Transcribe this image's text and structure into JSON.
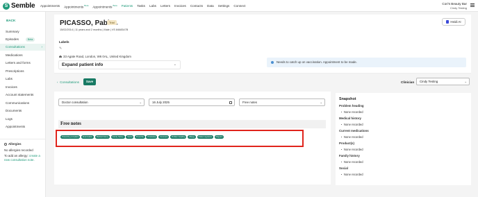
{
  "nav": {
    "logo": "Semble",
    "links": [
      {
        "label": "Appointments",
        "badge": ""
      },
      {
        "label": "Appointments",
        "badge": "Beta"
      },
      {
        "label": "Appointments",
        "badge": "Beta"
      },
      {
        "label": "Patients",
        "badge": ""
      },
      {
        "label": "Tasks",
        "badge": ""
      },
      {
        "label": "Labs",
        "badge": ""
      },
      {
        "label": "Letters",
        "badge": ""
      },
      {
        "label": "Invoices",
        "badge": ""
      },
      {
        "label": "Contacts",
        "badge": ""
      },
      {
        "label": "Data",
        "badge": ""
      },
      {
        "label": "Settings",
        "badge": ""
      },
      {
        "label": "Connect",
        "badge": ""
      }
    ],
    "account_name": "Cori's Beauty Bar",
    "account_sub": "Cindy Testing"
  },
  "sidebar": {
    "back": "BACK",
    "items": [
      {
        "label": "Summary"
      },
      {
        "label": "Episodes",
        "badge": "Beta"
      },
      {
        "label": "Consultations"
      },
      {
        "label": "Medications"
      },
      {
        "label": "Letters and forms"
      },
      {
        "label": "Prescriptions"
      },
      {
        "label": "Labs"
      },
      {
        "label": "Invoices"
      },
      {
        "label": "Account statements"
      },
      {
        "label": "Communications"
      },
      {
        "label": "Documents"
      },
      {
        "label": "Logs"
      },
      {
        "label": "Appointments"
      }
    ],
    "allergies_title": "Allergies",
    "allergies_none": "No allergies recorded",
    "allergies_add_prefix": "To add an allergy:",
    "allergies_add_link": "create a new consultation note."
  },
  "patient": {
    "name": "PICASSO, Pablo",
    "pronoun": "He",
    "tag": "Trial",
    "meta": "15/02/2014  |  11 years and 2 months  |  Male  |  VS 8468347B",
    "labels_title": "Labels",
    "address": "33 Agate Road, London, W6 0AL, United Kingdom",
    "expand_label": "Expand patient info",
    "reminder": "Needs to catch up on vaccination. Appointment to be made."
  },
  "header_actions": {
    "heidi": "Heidi AI"
  },
  "consult_bar": {
    "breadcrumb": "Consultations",
    "save": "Save",
    "clinician_label": "Clinician",
    "clinician_value": "Cindy Testing"
  },
  "form": {
    "type_value": "Doctor consultation",
    "date_value": "16 July 2025",
    "notes_value": "Free notes",
    "section_title": "Free notes",
    "chips": [
      "Presenting complaint",
      "Examination",
      "Medical history",
      "Family history",
      "Social",
      "Prescribe",
      "Product(s)",
      "Comment",
      "Problem heading",
      "Allergy",
      "Patient signature",
      "Diagram"
    ]
  },
  "snapshot": {
    "title": "Snapshot",
    "groups": [
      {
        "heading": "Problem heading",
        "item": "None recorded"
      },
      {
        "heading": "Medical history",
        "item": "None recorded"
      },
      {
        "heading": "Current medications",
        "item": "None recorded"
      },
      {
        "heading": "Product(s)",
        "item": "None recorded"
      },
      {
        "heading": "Family history",
        "item": "None recorded"
      },
      {
        "heading": "Social",
        "item": "None recorded"
      }
    ]
  },
  "colors": {
    "brand": "#1f9a7a",
    "button": "#187a64",
    "highlight": "#e0241c"
  }
}
